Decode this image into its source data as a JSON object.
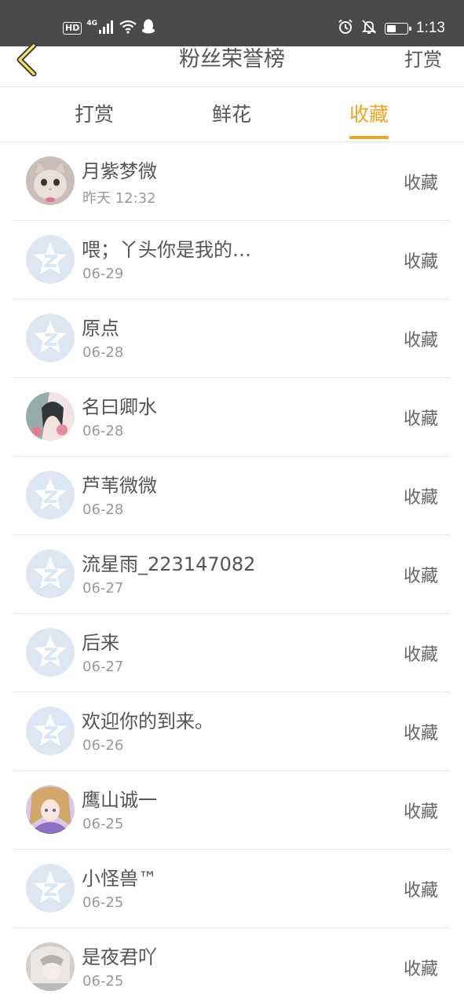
{
  "status_bar": {
    "hd": "HD",
    "network": "4G",
    "time": "1:13",
    "battery_level": 0.45,
    "icons": [
      "signal-icon",
      "wifi-icon",
      "qq-icon",
      "alarm-icon",
      "notifications-off-icon",
      "battery-icon"
    ]
  },
  "header": {
    "title": "粉丝荣誉榜",
    "right_link": "打赏",
    "back_icon": "chevron-left-icon"
  },
  "tabs": [
    {
      "label": "打赏",
      "active": false
    },
    {
      "label": "鲜花",
      "active": false
    },
    {
      "label": "收藏",
      "active": true
    }
  ],
  "colors": {
    "accent": "#f0a421",
    "default_avatar_bg": "#dde7f4",
    "status_bar": "#4a4a4a"
  },
  "fans": [
    {
      "name": "月紫梦微",
      "date": "昨天 12:32",
      "action": "收藏",
      "avatar": "cat-photo"
    },
    {
      "name": "喂；丫头你是我的…",
      "date": "06-29",
      "action": "收藏",
      "avatar": "default"
    },
    {
      "name": "原点",
      "date": "06-28",
      "action": "收藏",
      "avatar": "default"
    },
    {
      "name": "名曰卿水",
      "date": "06-28",
      "action": "收藏",
      "avatar": "illustration-pink"
    },
    {
      "name": "芦苇微微",
      "date": "06-28",
      "action": "收藏",
      "avatar": "default"
    },
    {
      "name": "流星雨_223147082",
      "date": "06-27",
      "action": "收藏",
      "avatar": "default"
    },
    {
      "name": "后来",
      "date": "06-27",
      "action": "收藏",
      "avatar": "default"
    },
    {
      "name": "欢迎你的到来。",
      "date": "06-26",
      "action": "收藏",
      "avatar": "default"
    },
    {
      "name": "鹰山诚一",
      "date": "06-25",
      "action": "收藏",
      "avatar": "illustration-anime"
    },
    {
      "name": "小怪兽™",
      "date": "06-25",
      "action": "收藏",
      "avatar": "default"
    },
    {
      "name": "是夜君吖",
      "date": "06-25",
      "action": "收藏",
      "avatar": "illustration-gray"
    }
  ]
}
